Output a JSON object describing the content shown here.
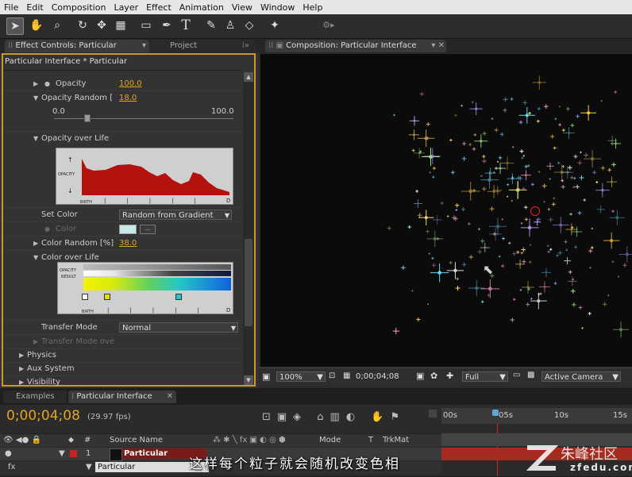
{
  "menu": [
    "File",
    "Edit",
    "Composition",
    "Layer",
    "Effect",
    "Animation",
    "View",
    "Window",
    "Help"
  ],
  "effect_panel": {
    "tab_effect": "Effect Controls: Particular",
    "tab_project": "Project",
    "breadcrumb": "Particular Interface * Particular",
    "opacity_label": "Opacity",
    "opacity_value": "100.0",
    "opacity_random_label": "Opacity Random [",
    "opacity_random_value": "18.0",
    "slider_min": "0.0",
    "slider_max": "100.0",
    "slider_level": 0.18,
    "opacity_over_life_label": "Opacity over Life",
    "graph_y_label": "OPACITY",
    "graph_x_label": "BIRTH",
    "graph_x_end": "D",
    "set_color_label": "Set Color",
    "set_color_value": "Random from Gradient",
    "color_label": "Color",
    "color_random_label": "Color Random [%]",
    "color_random_value": "38.0",
    "color_over_life_label": "Color over Life",
    "gradient_opacity_label": "OPACITY",
    "gradient_result_label": "RESULT",
    "gradient_birth_label": "BIRTH",
    "gradient_end_label": "D",
    "transfer_mode_label": "Transfer Mode",
    "transfer_mode_value": "Normal",
    "transfer_mode_over_label": "Transfer Mode ove",
    "physics_label": "Physics",
    "aux_label": "Aux System",
    "visibility_label": "Visibility"
  },
  "comp_panel": {
    "tab": "Composition: Particular Interface",
    "zoom": "100%",
    "timecode": "0;00;04;08",
    "resolution": "Full",
    "camera": "Active Camera"
  },
  "timeline": {
    "tab_examples": "Examples",
    "tab_interface": "Particular Interface",
    "timecode": "0;00;04;08",
    "fps": "(29.97 fps)",
    "col_num": "#",
    "col_source": "Source Name",
    "col_mode": "Mode",
    "col_t": "T",
    "col_trkmat": "TrkMat",
    "layer_num": "1",
    "layer_name": "Particular",
    "effect_name": "Particular",
    "ruler": [
      "00s",
      "05s",
      "10s",
      "15s"
    ]
  },
  "subtitle": "这样每个粒子就会随机改变色相",
  "watermark_url": "zfedu.com",
  "colors": {
    "accent": "#e3a521",
    "graph_fill": "#b3120f",
    "panel_border": "#c89a2b",
    "bg": "#1d1d1d"
  }
}
